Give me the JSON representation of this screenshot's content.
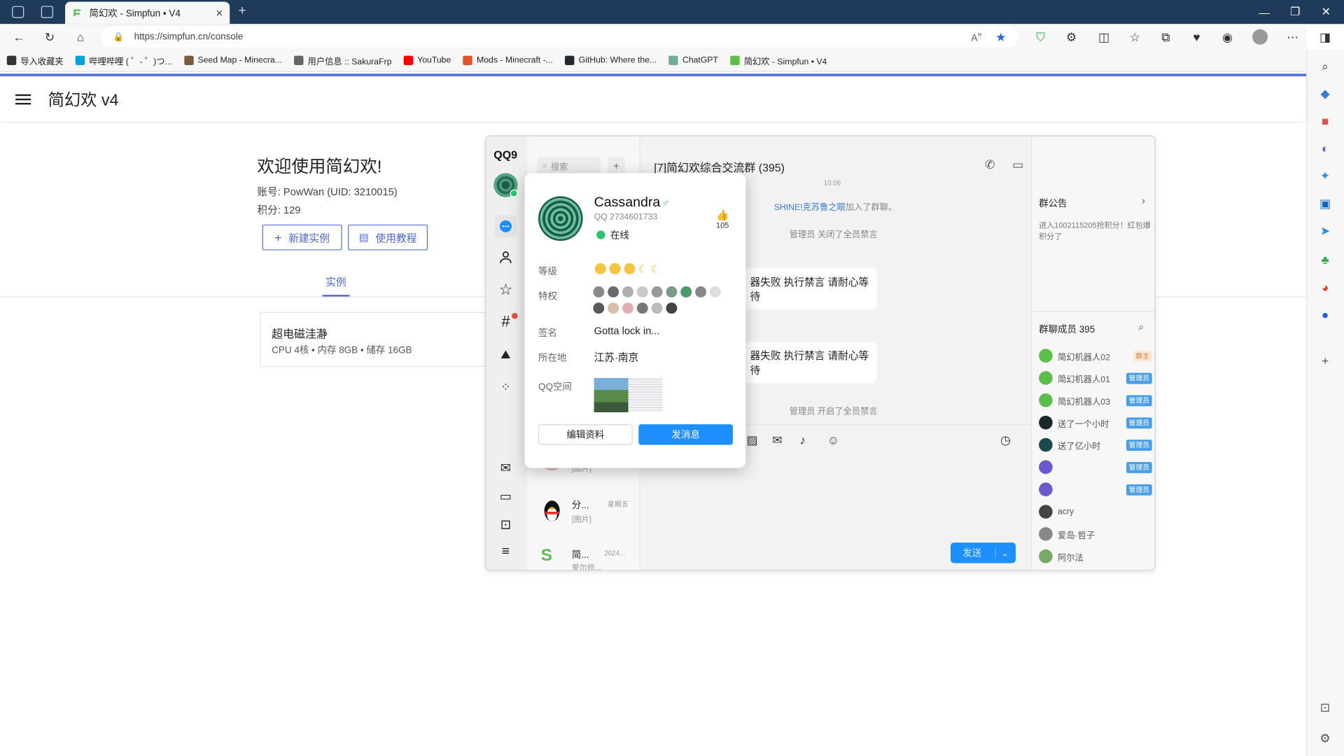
{
  "browser": {
    "tab_title": "简幻欢 - Simpfun • V4",
    "url": "https://simpfun.cn/console",
    "bookmarks": [
      {
        "label": "导入收藏夹",
        "color": "#333333"
      },
      {
        "label": "哔哩哔哩 ( ゜- ゜)つ...",
        "color": "#00a1d6"
      },
      {
        "label": "Seed Map - Minecra...",
        "color": "#7a5a3a"
      },
      {
        "label": "用户信息 :: SakuraFrp",
        "color": "#666666"
      },
      {
        "label": "YouTube",
        "color": "#ff0000"
      },
      {
        "label": "Mods - Minecraft -...",
        "color": "#e0542c"
      },
      {
        "label": "GitHub: Where the...",
        "color": "#24292e"
      },
      {
        "label": "ChatGPT",
        "color": "#74aa9c"
      },
      {
        "label": "简幻欢 - Simpfun • V4",
        "color": "#5bbf4a"
      }
    ]
  },
  "app": {
    "title": "简幻欢 v4",
    "welcome": "欢迎使用简幻欢!",
    "account": "账号: PowWan (UID: 3210015)",
    "score": "积分: 129",
    "new_instance": "新建实例",
    "tutorial": "使用教程",
    "tab_instances": "实例",
    "instance": {
      "name": "超电磁洼瀞",
      "specs": "CPU 4核 • 内存 8GB • 储存 16GB"
    },
    "accent": "#4b66d2"
  },
  "qq": {
    "logo": "QQ9",
    "search_placeholder": "搜索",
    "chat_title": "[7]简幻欢综合交流群 (395)",
    "time_fragment": "10:06",
    "sys1_user": "SHINE!克苏鲁之眼",
    "sys1_text": "加入了群聊。",
    "sys2": "管理员  关闭了全员禁言",
    "msg1": "器失败 执行禁言 请耐心等待",
    "msg2": "器失败 执行禁言 请耐心等待",
    "sys3": "管理员  开启了全员禁言",
    "send": "发送",
    "announcement_title": "群公告",
    "announcement_text": "进入1002115205抢积分！红包爆积分了",
    "members_title": "群聊成员 395",
    "members": [
      {
        "name": "简幻机器人02",
        "badge": "群主",
        "color": "#5bbf4a"
      },
      {
        "name": "简幻机器人01",
        "badge": "管理员",
        "color": "#5bbf4a"
      },
      {
        "name": "简幻机器人03",
        "badge": "管理员",
        "color": "#5bbf4a"
      },
      {
        "name": "送了一个小时",
        "badge": "管理员",
        "color": "#1a2a2a"
      },
      {
        "name": "送了亿小时",
        "badge": "管理员",
        "color": "#1a4a4a"
      },
      {
        "name": "",
        "badge": "管理员",
        "color": "#6a5acd"
      },
      {
        "name": "",
        "badge": "管理员",
        "color": "#6a5acd"
      },
      {
        "name": "acry",
        "badge": "",
        "color": "#444444"
      },
      {
        "name": "爱岛·哲子",
        "badge": "",
        "color": "#888888"
      },
      {
        "name": "阿尔法",
        "badge": "",
        "color": "#7aa86a"
      }
    ],
    "list_items": [
      {
        "title": "",
        "sub": "[图片]",
        "time": ""
      },
      {
        "title": "分...",
        "sub": "[图片]",
        "time": "星期五"
      },
      {
        "title": "简...",
        "sub": "爱尔修...",
        "time": "2024..."
      }
    ]
  },
  "profile": {
    "name": "Cassandra",
    "gender": "♂",
    "qq": "QQ 2734601733",
    "status": "在线",
    "likes": "105",
    "level_label": "等级",
    "privilege_label": "特权",
    "signature_label": "签名",
    "signature": "Gotta lock in...",
    "location_label": "所在地",
    "location": "江苏·南京",
    "qzone_label": "QQ空间",
    "edit_btn": "编辑资料",
    "msg_btn": "发消息",
    "primary": "#1e8fff"
  }
}
